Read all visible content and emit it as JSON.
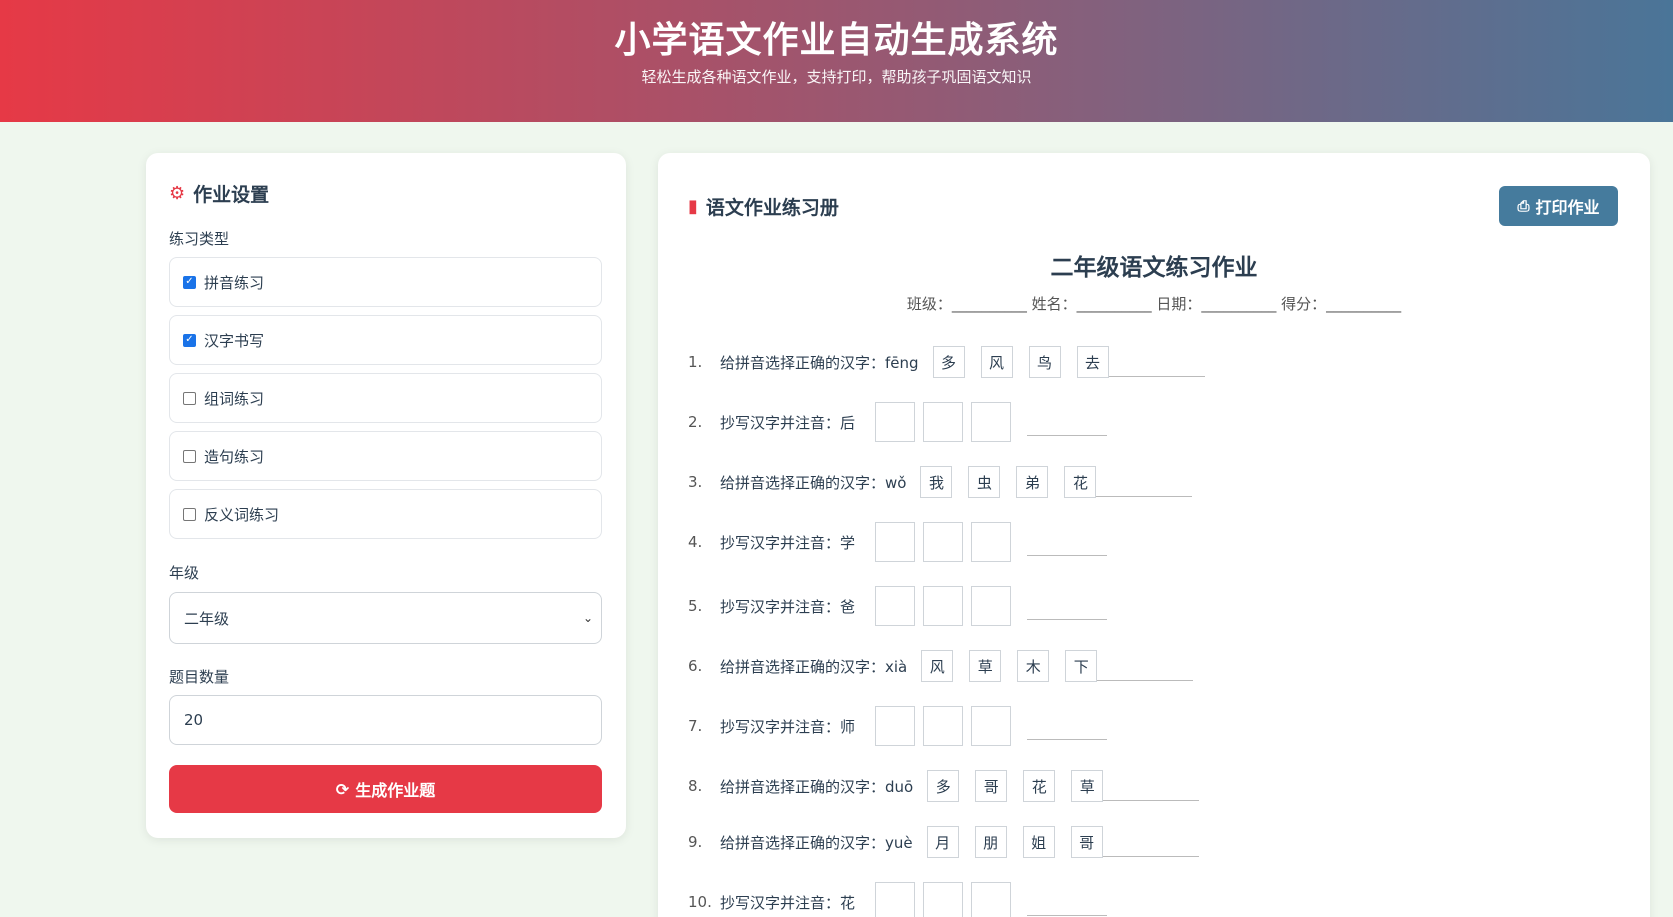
{
  "header": {
    "title": "小学语文作业自动生成系统",
    "subtitle": "轻松生成各种语文作业，支持打印，帮助孩子巩固语文知识"
  },
  "settings": {
    "title": "作业设置",
    "types_label": "练习类型",
    "types": [
      {
        "label": "拼音练习",
        "checked": true
      },
      {
        "label": "汉字书写",
        "checked": true
      },
      {
        "label": "组词练习",
        "checked": false
      },
      {
        "label": "造句练习",
        "checked": false
      },
      {
        "label": "反义词练习",
        "checked": false
      }
    ],
    "grade_label": "年级",
    "grade_value": "二年级",
    "count_label": "题目数量",
    "count_value": "20",
    "generate_label": "生成作业题"
  },
  "worksheet": {
    "title": "语文作业练习册",
    "print_label": "打印作业",
    "sheet_title": "二年级语文练习作业",
    "meta": "班级：__________ 姓名：__________ 日期：__________ 得分：__________",
    "questions": [
      {
        "num": "1.",
        "text": "给拼音选择正确的汉字：fēng",
        "choices": [
          "多",
          "风",
          "鸟",
          "去"
        ]
      },
      {
        "num": "2.",
        "text": "抄写汉字并注音：后"
      },
      {
        "num": "3.",
        "text": "给拼音选择正确的汉字：wǒ",
        "choices": [
          "我",
          "虫",
          "弟",
          "花"
        ]
      },
      {
        "num": "4.",
        "text": "抄写汉字并注音：学"
      },
      {
        "num": "5.",
        "text": "抄写汉字并注音：爸"
      },
      {
        "num": "6.",
        "text": "给拼音选择正确的汉字：xià",
        "choices": [
          "风",
          "草",
          "木",
          "下"
        ]
      },
      {
        "num": "7.",
        "text": "抄写汉字并注音：师"
      },
      {
        "num": "8.",
        "text": "给拼音选择正确的汉字：duō",
        "choices": [
          "多",
          "哥",
          "花",
          "草"
        ]
      },
      {
        "num": "9.",
        "text": "给拼音选择正确的汉字：yuè",
        "choices": [
          "月",
          "朋",
          "姐",
          "哥"
        ]
      },
      {
        "num": "10.",
        "text": "抄写汉字并注音：花"
      }
    ]
  },
  "icons": {
    "settings": "cogs-icon",
    "book": "book-icon",
    "print": "print-icon",
    "refresh": "refresh-icon"
  },
  "colors": {
    "accent_red": "#e63946",
    "accent_blue": "#457b9d",
    "background": "#eff7ee"
  }
}
